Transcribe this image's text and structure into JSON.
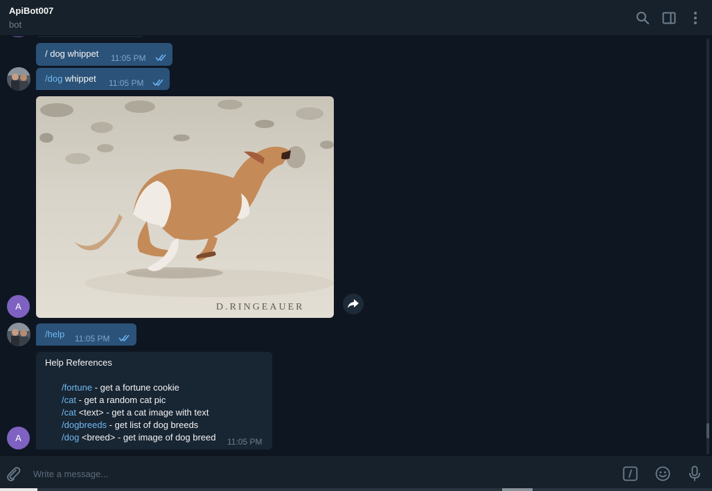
{
  "header": {
    "title": "ApiBot007",
    "subtitle": "bot",
    "icons": [
      "search-icon",
      "sidebar-toggle-icon",
      "more-vertical-icon"
    ]
  },
  "messages": {
    "m1": {
      "text": "/ dog whippet",
      "time": "11:05 PM",
      "status": "read"
    },
    "m2": {
      "command": "/dog",
      "text": " whippet",
      "time": "11:05 PM",
      "status": "read"
    },
    "photo": {
      "watermark": "D.RINGEAUER",
      "sender_initial": "A"
    },
    "m3": {
      "command": "/help",
      "time": "11:05 PM",
      "status": "read"
    },
    "help": {
      "title": "Help References",
      "lines": [
        {
          "command": "/fortune",
          "rest": " - get a fortune cookie"
        },
        {
          "command": "/cat",
          "rest": " - get a random cat pic"
        },
        {
          "command": "/cat",
          "rest": " <text> - get a cat image with text"
        },
        {
          "command": "/dogbreeds",
          "rest": " - get list of dog breeds"
        },
        {
          "command": "/dog",
          "rest": " <breed> - get image of dog breed"
        }
      ],
      "time": "11:05 PM",
      "sender_initial": "A"
    }
  },
  "composer": {
    "placeholder": "Write a message...",
    "icons": [
      "paperclip-icon",
      "bot-commands-icon",
      "emoji-icon",
      "microphone-icon"
    ]
  },
  "scroll": {
    "position_fraction": 0.96
  },
  "colors": {
    "background": "#0e1621",
    "header": "#17212b",
    "outgoing_bubble": "#2b5278",
    "incoming_bubble": "#182533",
    "command_link": "#71baf1",
    "avatar_accent": "#7e61c1"
  }
}
